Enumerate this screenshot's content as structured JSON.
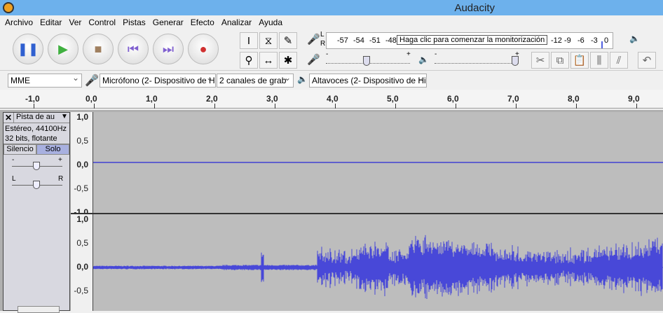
{
  "window": {
    "title": "Audacity"
  },
  "menu": [
    "Archivo",
    "Editar",
    "Ver",
    "Control",
    "Pistas",
    "Generar",
    "Efecto",
    "Analizar",
    "Ayuda"
  ],
  "transport": [
    {
      "icon": "pause-icon",
      "glyph": "❚❚"
    },
    {
      "icon": "play-icon",
      "glyph": "▶"
    },
    {
      "icon": "stop-icon",
      "glyph": "■"
    },
    {
      "icon": "skip-start-icon",
      "glyph": "⏮"
    },
    {
      "icon": "skip-end-icon",
      "glyph": "⏭"
    },
    {
      "icon": "record-icon",
      "glyph": "●"
    }
  ],
  "tools": [
    {
      "icon": "selection-tool-icon",
      "glyph": "I"
    },
    {
      "icon": "envelope-tool-icon",
      "glyph": "⧖"
    },
    {
      "icon": "draw-tool-icon",
      "glyph": "✎"
    },
    {
      "icon": "zoom-tool-icon",
      "glyph": "⚲"
    },
    {
      "icon": "timeshift-tool-icon",
      "glyph": "↔"
    },
    {
      "icon": "multi-tool-icon",
      "glyph": "✱"
    }
  ],
  "meters": {
    "record_scale": [
      "-57",
      "-54",
      "-51",
      "-48"
    ],
    "tooltip": "Haga clic para comenzar la monitorización",
    "record_scale_right": [
      "-12",
      "-9",
      "-6",
      "-3",
      "0"
    ],
    "L": "L",
    "R": "R"
  },
  "mixer": {
    "minus": "-",
    "plus": "+",
    "input_level": 0.5,
    "output_level": 1.0
  },
  "edit_tools": [
    "cut-icon",
    "copy-icon",
    "paste-icon",
    "trim-icon",
    "silence-icon",
    "undo-icon"
  ],
  "devices": {
    "host": "MME",
    "mic": "Micrófono (2- Dispositivo de H",
    "channels": "2 canales de grab",
    "speaker": "Altavoces (2- Dispositivo de Hi"
  },
  "ruler": [
    "-1,0",
    "0,0",
    "1,0",
    "2,0",
    "3,0",
    "4,0",
    "5,0",
    "6,0",
    "7,0",
    "8,0",
    "9,0"
  ],
  "track": {
    "name": "Pista de au",
    "info1": "Estéreo, 44100Hz",
    "info2": "32 bits, flotante",
    "mute": "Silencio",
    "solo": "Solo",
    "gain_minus": "-",
    "gain_plus": "+",
    "pan_l": "L",
    "pan_r": "R"
  },
  "vscale": [
    "1,0",
    "0,5",
    "0,0",
    "-0,5",
    "-1,0"
  ],
  "colors": {
    "wave": "#3232c8",
    "solo_active": "#a8b0e0",
    "titlebar": "#6db1ec"
  }
}
